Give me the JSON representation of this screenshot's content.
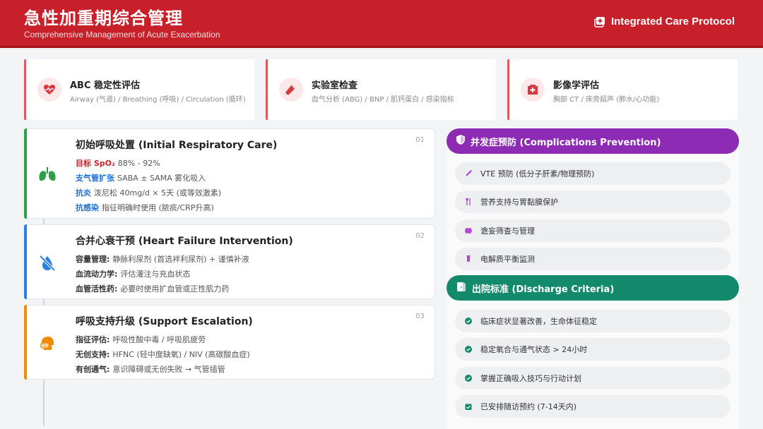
{
  "header": {
    "title": "急性加重期综合管理",
    "subtitle": "Comprehensive Management of Acute Exacerbation",
    "brand": "Integrated Care Protocol"
  },
  "top_cards": [
    {
      "title": "ABC 稳定性评估",
      "sub": "Airway (气道) / Breathing (呼吸) / Circulation (循环)",
      "icon": "heart-pulse-icon"
    },
    {
      "title": "实验室检查",
      "sub": "血气分析 (ABG) / BNP / 肌钙蛋白 / 感染指标",
      "icon": "test-tube-icon"
    },
    {
      "title": "影像学评估",
      "sub": "胸部 CT / 床旁超声 (肺水/心功能)",
      "icon": "hospital-icon"
    }
  ],
  "steps": [
    {
      "number": "01",
      "title": "初始呼吸处置 (Initial Respiratory Care)",
      "icon": "lungs-icon",
      "color": "#2e9e49",
      "lines": [
        {
          "k": "目标 SpO₂",
          "v": "88% - 92%",
          "kcolor": "#c8202a"
        },
        {
          "k": "支气管扩张",
          "v": "SABA ± SAMA 雾化吸入",
          "kcolor": "#1e6fd9"
        },
        {
          "k": "抗炎",
          "v": "泼尼松 40mg/d × 5天 (或等效激素)",
          "kcolor": "#1e6fd9"
        },
        {
          "k": "抗感染",
          "v": "指征明确时使用 (脓痰/CRP升高)",
          "kcolor": "#1e6fd9"
        }
      ]
    },
    {
      "number": "02",
      "title": "合并心衰干预 (Heart Failure Intervention)",
      "icon": "no-drop-icon",
      "color": "#2b7fe0",
      "lines": [
        {
          "k": "容量管理:",
          "v": "静脉利尿剂 (首选袢利尿剂) + 谨慎补液",
          "kcolor": "#333333"
        },
        {
          "k": "血流动力学:",
          "v": "评估灌注与充血状态",
          "kcolor": "#333333"
        },
        {
          "k": "血管活性药:",
          "v": "必要时使用扩血管或正性肌力药",
          "kcolor": "#333333"
        }
      ]
    },
    {
      "number": "03",
      "title": "呼吸支持升级 (Support Escalation)",
      "icon": "head-side-mask-icon",
      "color": "#f08c00",
      "lines": [
        {
          "k": "指征评估:",
          "v": "呼吸性酸中毒 / 呼吸肌疲劳",
          "kcolor": "#333333"
        },
        {
          "k": "无创支持:",
          "v": "HFNC (轻中度缺氧) / NIV (高碳酸血症)",
          "kcolor": "#333333"
        },
        {
          "k": "有创通气:",
          "v": "意识障碍或无创失败 → 气管插管",
          "kcolor": "#333333"
        }
      ]
    }
  ],
  "complications": {
    "title": "并发症预防 (Complications Prevention)",
    "color": "#8e2bb5",
    "icon_color": "#b046d6",
    "items": [
      {
        "text": "VTE 预防 (低分子肝素/物理预防)",
        "icon": "syringe-icon"
      },
      {
        "text": "营养支持与胃黏膜保护",
        "icon": "utensils-icon"
      },
      {
        "text": "谵妄筛查与管理",
        "icon": "brain-icon"
      },
      {
        "text": "电解质平衡监测",
        "icon": "vial-icon"
      }
    ]
  },
  "discharge": {
    "title": "出院标准 (Discharge Criteria)",
    "color": "#128a6b",
    "icon_color": "#128a6b",
    "items": [
      {
        "text": "临床症状显著改善，生命体征稳定",
        "icon": "check-circle-icon"
      },
      {
        "text": "稳定氧合与通气状态 > 24小时",
        "icon": "check-circle-icon"
      },
      {
        "text": "掌握正确吸入技巧与行动计划",
        "icon": "check-circle-icon"
      },
      {
        "text": "已安排随访预约 (7-14天内)",
        "icon": "calendar-check-icon"
      }
    ]
  }
}
